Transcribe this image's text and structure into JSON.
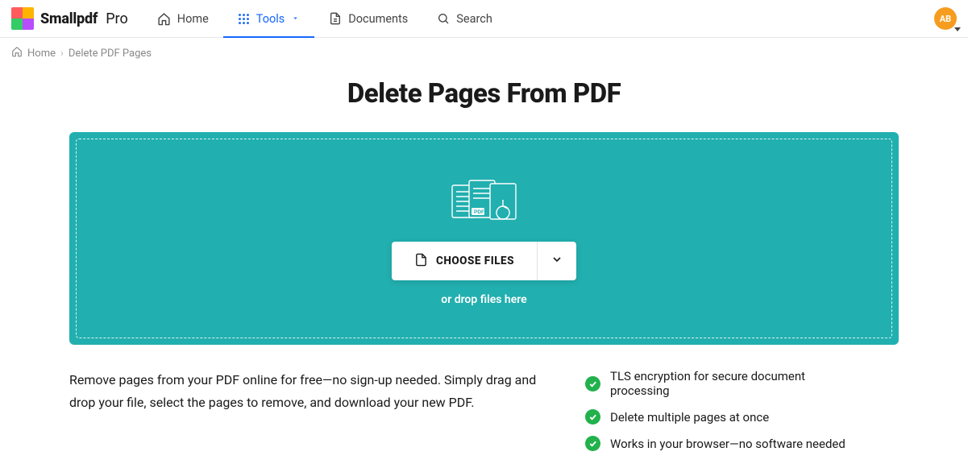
{
  "brand": {
    "name": "Smallpdf",
    "tier": "Pro"
  },
  "nav": {
    "home": "Home",
    "tools": "Tools",
    "documents": "Documents",
    "search": "Search"
  },
  "avatar": {
    "initials": "AB"
  },
  "breadcrumb": {
    "home": "Home",
    "current": "Delete PDF Pages"
  },
  "page": {
    "title": "Delete Pages From PDF",
    "choose_label": "CHOOSE FILES",
    "drop_hint": "or drop files here",
    "description": "Remove pages from your PDF online for free—no sign-up needed. Simply drag and drop your file, select the pages to remove, and download your new PDF."
  },
  "features": [
    "TLS encryption for secure document processing",
    "Delete multiple pages at once",
    "Works in your browser—no software needed"
  ]
}
